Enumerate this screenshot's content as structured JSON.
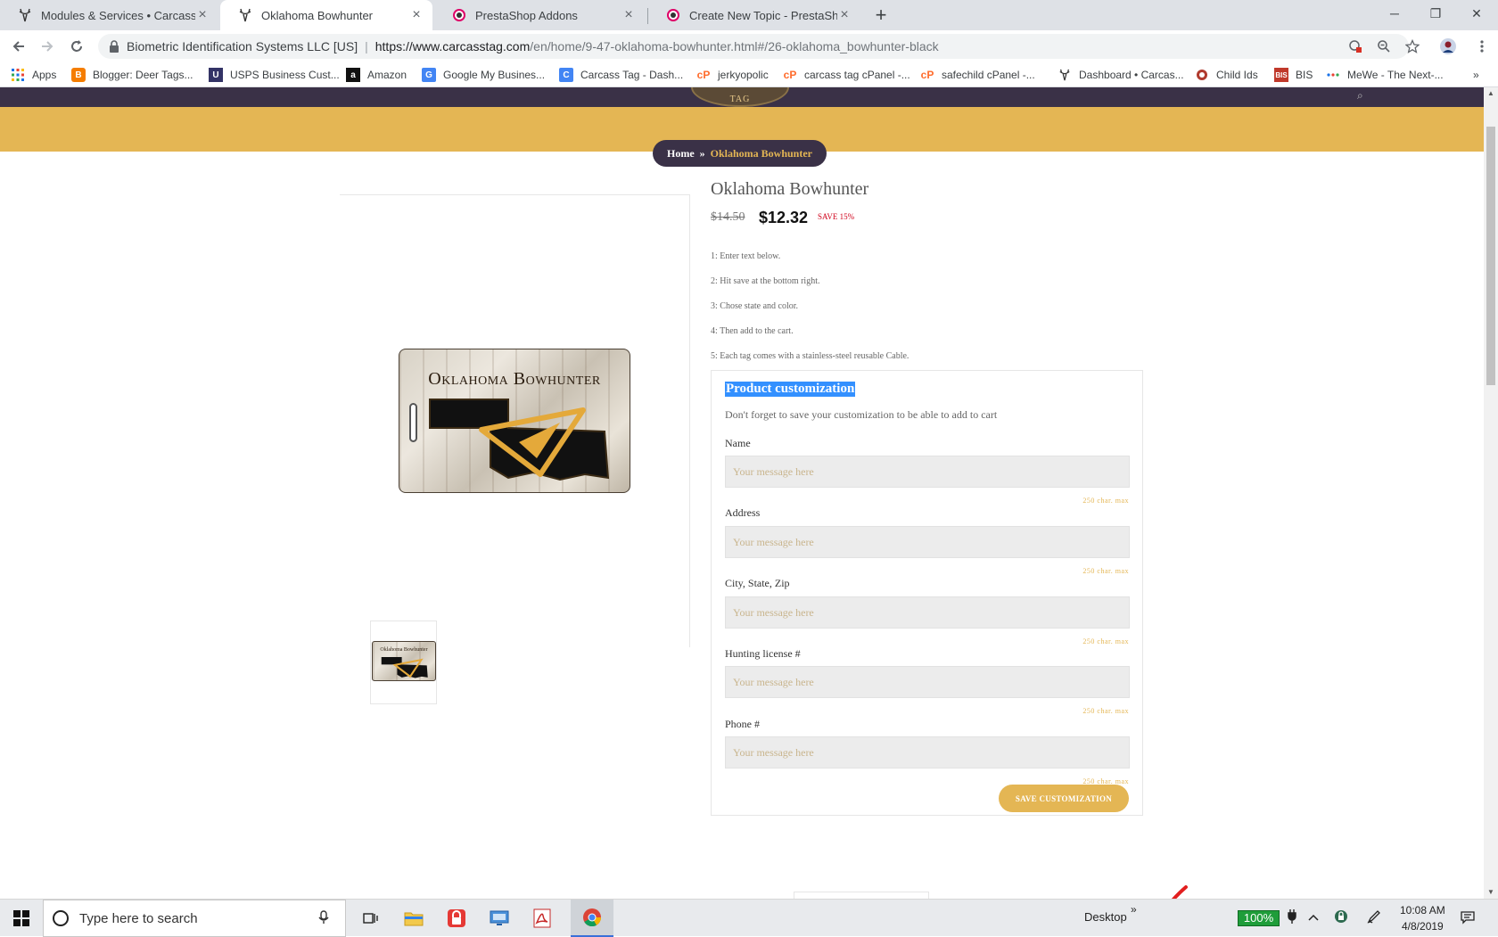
{
  "browser": {
    "tabs": [
      {
        "title": "Modules & Services • Carcass Tag",
        "active": false
      },
      {
        "title": "Oklahoma Bowhunter",
        "active": true
      },
      {
        "title": "PrestaShop Addons",
        "active": false
      },
      {
        "title": "Create New Topic - PrestaShop F",
        "active": false
      }
    ],
    "new_tab": "+",
    "window": {
      "minimize": "─",
      "restore": "❐",
      "close": "✕"
    },
    "address": {
      "org": "Biometric Identification Systems LLC [US]",
      "url_host": "https://www.carcasstag.com",
      "url_path": "/en/home/9-47-oklahoma-bowhunter.html#/26-oklahoma_bowhunter-black"
    },
    "bookmarks": [
      {
        "label": "Apps",
        "icon": "apps-grid-icon",
        "color": "#1a73e8"
      },
      {
        "label": "Blogger: Deer Tags...",
        "icon": "blogger-icon",
        "color": "#f57d00"
      },
      {
        "label": "USPS Business Cust...",
        "icon": "usps-icon",
        "color": "#333366"
      },
      {
        "label": "Amazon",
        "icon": "amazon-icon",
        "color": "#111111"
      },
      {
        "label": "Google My Busines...",
        "icon": "google-my-business-icon",
        "color": "#4285f4"
      },
      {
        "label": "Carcass Tag - Dash...",
        "icon": "carcass-tag-icon",
        "color": "#4285f4"
      },
      {
        "label": "jerkyopolic",
        "icon": "cpanel-icon",
        "color": "#ff6c2c"
      },
      {
        "label": "carcass tag cPanel -...",
        "icon": "cpanel-icon",
        "color": "#ff6c2c"
      },
      {
        "label": "safechild cPanel -...",
        "icon": "cpanel-icon",
        "color": "#ff6c2c"
      },
      {
        "label": "Dashboard • Carcas...",
        "icon": "deer-icon",
        "color": "#333333"
      },
      {
        "label": "Child Ids",
        "icon": "child-ids-icon",
        "color": "#b03a2e"
      },
      {
        "label": "BIS",
        "icon": "bis-icon",
        "color": "#c0392b"
      },
      {
        "label": "MeWe - The Next-...",
        "icon": "mewe-icon",
        "color": "#1a73e8"
      }
    ],
    "bookmarks_more": "»"
  },
  "site": {
    "logo_text": "TAG",
    "accent_color": "#e4b654",
    "dark_color": "#3a3147",
    "breadcrumb": {
      "home": "Home",
      "separator": "»",
      "current": "Oklahoma Bowhunter"
    }
  },
  "product": {
    "name": "Oklahoma Bowhunter",
    "tag_image_title": "Oklahoma Bowhunter",
    "price_old": "$14.50",
    "price_new": "$12.32",
    "save": "SAVE 15%",
    "instructions": [
      "1: Enter text below.",
      "2: Hit save at the bottom right.",
      "3: Chose state and color.",
      "4: Then add to the cart.",
      "5: Each tag comes with a stainless-steel reusable Cable."
    ],
    "customization": {
      "title": "Product customization",
      "note": "Don't forget to save your customization to be able to add to cart",
      "fields": [
        {
          "label": "Name",
          "placeholder": "Your message here",
          "max": "250 char. max"
        },
        {
          "label": "Address",
          "placeholder": "Your message here",
          "max": "250 char. max"
        },
        {
          "label": "City, State, Zip",
          "placeholder": "Your message here",
          "max": "250 char. max"
        },
        {
          "label": "Hunting license #",
          "placeholder": "Your message here",
          "max": "250 char. max"
        },
        {
          "label": "Phone #",
          "placeholder": "Your message here",
          "max": "250 char. max"
        }
      ],
      "save_button": "SAVE CUSTOMIZATION"
    }
  },
  "taskbar": {
    "search_placeholder": "Type here to search",
    "desktop": "Desktop",
    "desktop_chevron": "»",
    "battery": "100%",
    "time": "10:08 AM",
    "date": "4/8/2019"
  }
}
